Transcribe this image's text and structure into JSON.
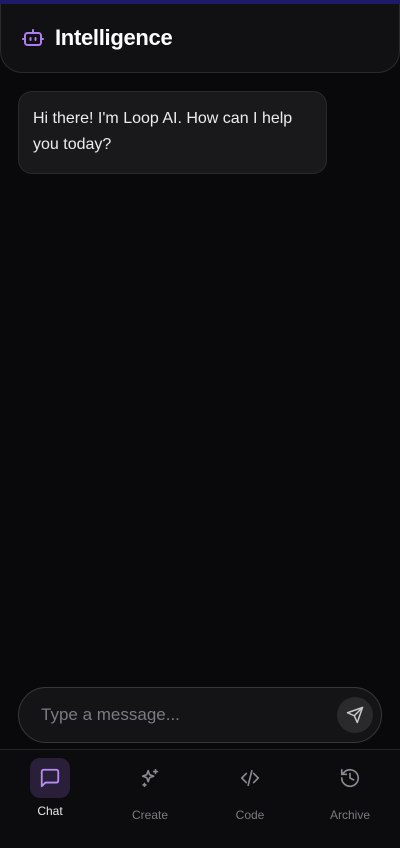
{
  "header": {
    "title": "Intelligence",
    "logo_icon": "robot-icon",
    "accent": "#b07cf0"
  },
  "messages": [
    {
      "role": "assistant",
      "text": "Hi there! I'm Loop AI. How can I help you today?"
    }
  ],
  "composer": {
    "placeholder": "Type a message...",
    "value": "",
    "send_icon": "send-icon"
  },
  "nav": {
    "items": [
      {
        "label": "Chat",
        "icon": "chat-icon",
        "active": true
      },
      {
        "label": "Create",
        "icon": "sparkles-icon",
        "active": false
      },
      {
        "label": "Code",
        "icon": "code-icon",
        "active": false
      },
      {
        "label": "Archive",
        "icon": "history-icon",
        "active": false
      }
    ]
  },
  "colors": {
    "background": "#09090b",
    "active_nav_bg": "#2a1f38",
    "active_nav_icon": "#b48ef0",
    "inactive": "#7a7a80"
  }
}
